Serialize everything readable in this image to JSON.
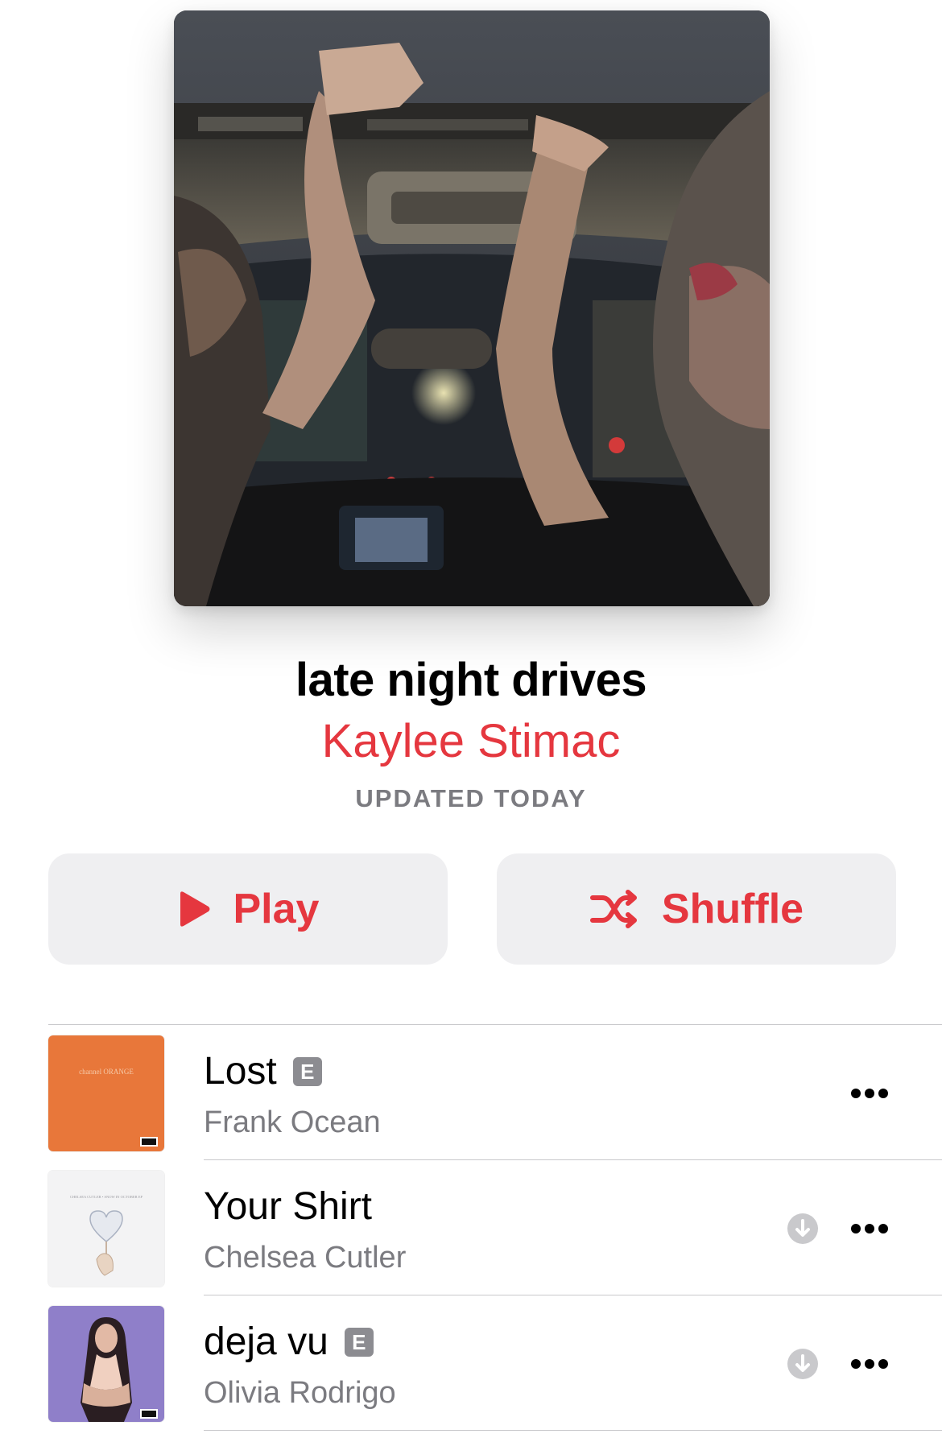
{
  "header": {
    "title": "late night drives",
    "curator": "Kaylee Stimac",
    "updated": "UPDATED TODAY",
    "artwork_icon": "playlist-cover-image"
  },
  "actions": {
    "play_label": "Play",
    "shuffle_label": "Shuffle",
    "play_icon": "play-icon",
    "shuffle_icon": "shuffle-icon"
  },
  "colors": {
    "accent": "#e5373f",
    "secondary_text": "#7b7b80",
    "button_bg": "#efeff1"
  },
  "tracks": [
    {
      "title": "Lost",
      "artist": "Frank Ocean",
      "explicit": true,
      "explicit_label": "E",
      "downloadable": false,
      "art_text": "channel ORANGE"
    },
    {
      "title": "Your Shirt",
      "artist": "Chelsea Cutler",
      "explicit": false,
      "downloadable": true,
      "art_text": "CHELSEA CUTLER • SNOW IN OCTOBER EP"
    },
    {
      "title": "deja vu",
      "artist": "Olivia Rodrigo",
      "explicit": true,
      "explicit_label": "E",
      "downloadable": true
    }
  ]
}
